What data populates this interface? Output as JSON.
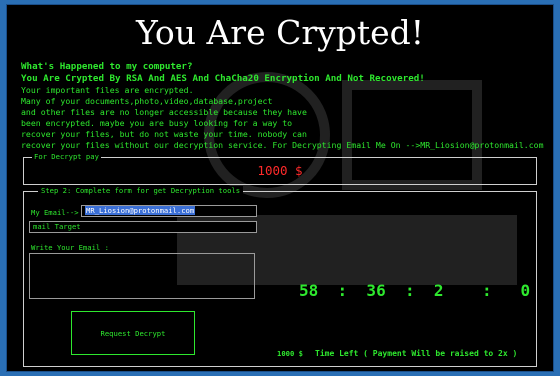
{
  "title": "You Are Crypted!",
  "message": {
    "heading1": "What's Happened to my computer?",
    "heading2": "You Are Crypted By RSA And AES And ChaCha20 Encryption And Not Recovered!",
    "lines": [
      "Your important files are encrypted.",
      "Many of your documents,photo,video,database,project",
      "and other files are no longer accessible because they have",
      "been encrypted. maybe you are busy looking for a way to",
      "recover your files, but do not waste your time.  nobody can",
      "recover your files without our decryption service. For Decrypting Email Me On -->MR_Liosion@protonmail.com"
    ]
  },
  "payment": {
    "legend": "For Decrypt pay",
    "amount": "1000 $"
  },
  "form": {
    "legend": "Step 2: Complete form for get Decryption tools",
    "email_label": "My Email-->",
    "email_value": "MR_Liosion@protonmail.com",
    "second_field_value": "mail Target",
    "write_label": "Write Your Email :",
    "button_label": "Request Decrypt"
  },
  "timer": {
    "display": "58  :  36  :  2    :   0"
  },
  "footer": {
    "amount": "1000 $",
    "time_left": "Time Left ( Payment Will be raised to 2x )"
  },
  "colors": {
    "background": "#000000",
    "text": "#2ee82e",
    "amount": "#ff2a2a",
    "outer": "#2a6fb5"
  }
}
